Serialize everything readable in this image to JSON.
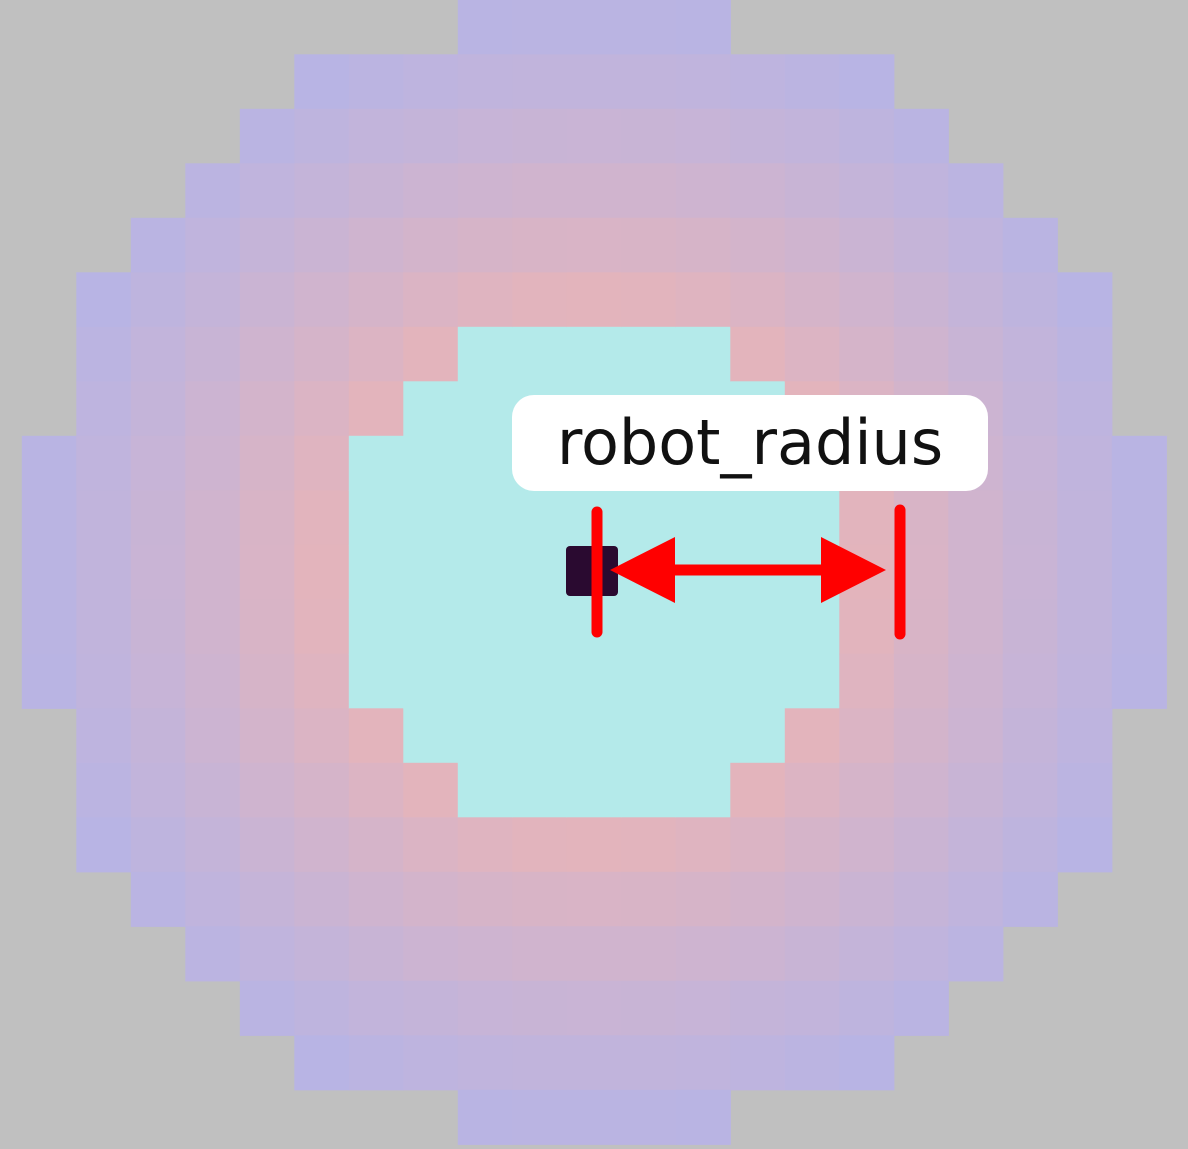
{
  "label": "robot_radius",
  "colors": {
    "background": "#c0c0c0",
    "inflation_outer": "#b8b4e4",
    "inflation_inner": "#e8b4b8",
    "free_space": "#b4eaea",
    "robot": "#2a0a30",
    "arrow": "#ff0000",
    "label_bg": "#ffffff"
  },
  "icons": {
    "robot": "robot-marker",
    "arrow": "double-headed-arrow"
  }
}
